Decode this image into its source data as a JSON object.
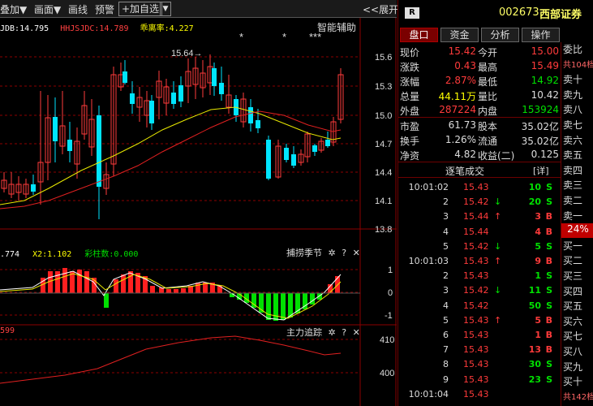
{
  "toolbar": {
    "overlay": "叠加",
    "draw": "画面",
    "line": "画线",
    "alert": "预警",
    "add_fav": "+加自选",
    "expand": "<<展开"
  },
  "indicator_bar": {
    "items": [
      {
        "text": "JDB:14.795",
        "color": "#ffffff"
      },
      {
        "text": "HHJSJDC:14.789",
        "color": "#ff4040"
      },
      {
        "text": "乖离率:4.227",
        "color": "#ffff00"
      }
    ],
    "panel_title": "智能辅助"
  },
  "main_chart": {
    "high_marker": "15.64→",
    "axis_labels": [
      "15.6",
      "15.3",
      "15.0",
      "14.7",
      "14.4",
      "14.1",
      "13.8"
    ],
    "stars": [
      "*",
      "*",
      "***"
    ]
  },
  "sub1": {
    "title": "捕捞季节",
    "labels": [
      {
        "text": ".774",
        "color": "#ffffff"
      },
      {
        "text": "X2:1.102",
        "color": "#ffff00"
      },
      {
        "text": "彩柱数:0.000",
        "color": "#00e000"
      }
    ],
    "axis_labels": [
      "1",
      "0",
      "-1"
    ]
  },
  "sub2": {
    "title": "主力追踪",
    "label": "599",
    "axis_labels": [
      "410",
      "400"
    ]
  },
  "right_panel": {
    "badge": "R",
    "code": "002673",
    "name": "西部证券",
    "tabs": [
      "盘口",
      "资金",
      "分析",
      "操作"
    ],
    "quote_rows": [
      [
        {
          "t": "现价",
          "c": "white"
        },
        {
          "t": "15.42",
          "c": "red"
        },
        {
          "t": "今开",
          "c": "white"
        },
        {
          "t": "15.00",
          "c": "red"
        }
      ],
      [
        {
          "t": "涨跌",
          "c": "white"
        },
        {
          "t": "0.43",
          "c": "red"
        },
        {
          "t": "最高",
          "c": "white"
        },
        {
          "t": "15.49",
          "c": "red"
        }
      ],
      [
        {
          "t": "涨幅",
          "c": "white"
        },
        {
          "t": "2.87%",
          "c": "red"
        },
        {
          "t": "最低",
          "c": "white"
        },
        {
          "t": "14.92",
          "c": "green"
        }
      ],
      [
        {
          "t": "总量",
          "c": "white"
        },
        {
          "t": "44.11万",
          "c": "yellow"
        },
        {
          "t": "量比",
          "c": "white"
        },
        {
          "t": "10.42",
          "c": "white"
        }
      ],
      [
        {
          "t": "外盘",
          "c": "white"
        },
        {
          "t": "287224",
          "c": "red"
        },
        {
          "t": "内盘",
          "c": "white"
        },
        {
          "t": "153924",
          "c": "green"
        }
      ]
    ],
    "quote_rows2": [
      [
        {
          "t": "市盈",
          "c": "white"
        },
        {
          "t": "61.73",
          "c": "white"
        },
        {
          "t": "股本",
          "c": "white"
        },
        {
          "t": "35.02亿",
          "c": "white"
        }
      ],
      [
        {
          "t": "换手",
          "c": "white"
        },
        {
          "t": "1.26%",
          "c": "white"
        },
        {
          "t": "流通",
          "c": "white"
        },
        {
          "t": "35.02亿",
          "c": "white"
        }
      ],
      [
        {
          "t": "净资",
          "c": "white"
        },
        {
          "t": "4.82",
          "c": "white"
        },
        {
          "t": "收益(二)",
          "c": "white"
        },
        {
          "t": "0.125",
          "c": "white"
        }
      ]
    ],
    "ticks_title": "逐笔成交",
    "ticks_detail": "[详]",
    "ticks": [
      {
        "time": "10:01:02",
        "price": "15.43",
        "arrow": "",
        "vol": "10",
        "side": "S"
      },
      {
        "time": "2",
        "price": "15.42",
        "arrow": "↓",
        "vol": "20",
        "side": "S"
      },
      {
        "time": "3",
        "price": "15.44",
        "arrow": "↑",
        "vol": "3",
        "side": "B"
      },
      {
        "time": "4",
        "price": "15.44",
        "arrow": "",
        "vol": "4",
        "side": "B"
      },
      {
        "time": "5",
        "price": "15.42",
        "arrow": "↓",
        "vol": "5",
        "side": "S"
      },
      {
        "time": "10:01:03",
        "price": "15.43",
        "arrow": "↑",
        "vol": "9",
        "side": "B"
      },
      {
        "time": "2",
        "price": "15.43",
        "arrow": "",
        "vol": "1",
        "side": "S"
      },
      {
        "time": "3",
        "price": "15.42",
        "arrow": "↓",
        "vol": "11",
        "side": "S"
      },
      {
        "time": "4",
        "price": "15.42",
        "arrow": "",
        "vol": "50",
        "side": "S"
      },
      {
        "time": "5",
        "price": "15.43",
        "arrow": "↑",
        "vol": "5",
        "side": "B"
      },
      {
        "time": "6",
        "price": "15.43",
        "arrow": "",
        "vol": "1",
        "side": "B"
      },
      {
        "time": "7",
        "price": "15.43",
        "arrow": "",
        "vol": "13",
        "side": "B"
      },
      {
        "time": "8",
        "price": "15.43",
        "arrow": "",
        "vol": "30",
        "side": "S"
      },
      {
        "time": "9",
        "price": "15.43",
        "arrow": "",
        "vol": "23",
        "side": "S"
      },
      {
        "time": "10:01:04",
        "price": "15.43",
        "arrow": "",
        "vol": "",
        "side": ""
      }
    ],
    "side_labels": [
      "委比",
      "共104档",
      "卖十",
      "卖九",
      "卖八",
      "卖七",
      "卖六",
      "卖五",
      "卖四",
      "卖三",
      "卖二",
      "卖一",
      "24%",
      "买一",
      "买二",
      "买三",
      "买四",
      "买五",
      "买六",
      "买七",
      "买八",
      "买九",
      "买十",
      "共142档"
    ]
  }
}
